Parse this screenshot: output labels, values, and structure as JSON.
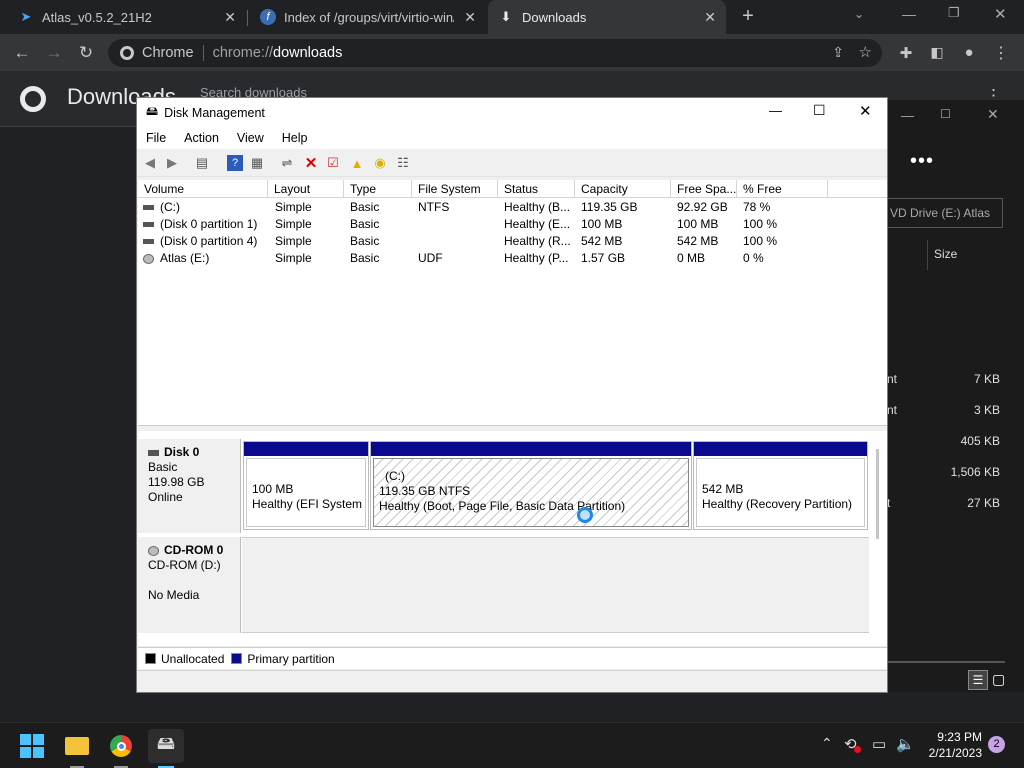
{
  "chrome": {
    "tabs": [
      {
        "title": "Atlas_v0.5.2_21H2"
      },
      {
        "title": "Index of /groups/virt/virtio-win/d"
      },
      {
        "title": "Downloads"
      }
    ],
    "new_tab": "+",
    "omnibox": {
      "scheme_label": "Chrome",
      "url_prefix": "chrome://",
      "url_path": "downloads"
    },
    "page_title": "Downloads",
    "search_placeholder": "Search downloads"
  },
  "bg_window": {
    "field_text": "VD Drive (E:) Atlas",
    "size_header": "Size",
    "rows": [
      {
        "name": "nt",
        "size": "7 KB"
      },
      {
        "name": "nt",
        "size": "3 KB"
      },
      {
        "name": "",
        "size": "405 KB"
      },
      {
        "name": "",
        "size": "1,506 KB"
      },
      {
        "name": "t",
        "size": "27 KB"
      }
    ]
  },
  "disk_mgmt": {
    "title": "Disk Management",
    "menu": [
      "File",
      "Action",
      "View",
      "Help"
    ],
    "columns": [
      "Volume",
      "Layout",
      "Type",
      "File System",
      "Status",
      "Capacity",
      "Free Spa...",
      "% Free"
    ],
    "volumes": [
      [
        "(C:)",
        "Simple",
        "Basic",
        "NTFS",
        "Healthy (B...",
        "119.35 GB",
        "92.92 GB",
        "78 %"
      ],
      [
        "(Disk 0 partition 1)",
        "Simple",
        "Basic",
        "",
        "Healthy (E...",
        "100 MB",
        "100 MB",
        "100 %"
      ],
      [
        "(Disk 0 partition 4)",
        "Simple",
        "Basic",
        "",
        "Healthy (R...",
        "542 MB",
        "542 MB",
        "100 %"
      ],
      [
        "Atlas (E:)",
        "Simple",
        "Basic",
        "UDF",
        "Healthy (P...",
        "1.57 GB",
        "0 MB",
        "0 %"
      ]
    ],
    "disk0": {
      "name": "Disk 0",
      "type": "Basic",
      "size": "119.98 GB",
      "state": "Online",
      "partitions": [
        {
          "title": "",
          "line1": "100 MB",
          "line2": "Healthy (EFI System P"
        },
        {
          "title": "(C:)",
          "line1": "119.35 GB NTFS",
          "line2": "Healthy (Boot, Page File, Basic Data Partition)"
        },
        {
          "title": "",
          "line1": "542 MB",
          "line2": "Healthy (Recovery Partition)"
        }
      ]
    },
    "cdrom": {
      "name": "CD-ROM 0",
      "type": "CD-ROM (D:)",
      "state": "No Media"
    },
    "legend": {
      "unallocated": "Unallocated",
      "primary": "Primary partition"
    },
    "colors": {
      "primary": "#0a0a8c",
      "unallocated": "#000000"
    }
  },
  "taskbar": {
    "time": "9:23 PM",
    "date": "2/21/2023",
    "notification_count": "2"
  }
}
